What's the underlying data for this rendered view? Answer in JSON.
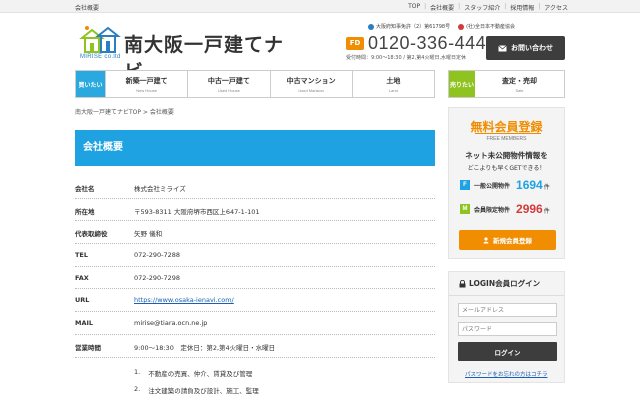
{
  "topbar": {
    "page_label": "会社概要",
    "links": [
      "TOP",
      "会社概要",
      "スタッフ紹介",
      "採用情報",
      "アクセス"
    ]
  },
  "logo": {
    "brand_jp": "南大阪一戸建てナビ",
    "brand_en": "MIRISE co.ltd"
  },
  "licenses": {
    "license1": "大阪府知事免許（2）第61798号",
    "license2": "(社)全日本不動産協会"
  },
  "contact": {
    "free_dial": "FD",
    "tel": "0120-336-444",
    "hours": "受付時間：9:00～18:30 / 第2,第4火曜日,水曜日定休",
    "inquiry_button": "お問い合わせ"
  },
  "nav": {
    "buy_label": "買いたい",
    "items": [
      {
        "jp": "新築一戸建て",
        "en": "New House"
      },
      {
        "jp": "中古一戸建て",
        "en": "Used House"
      },
      {
        "jp": "中古マンション",
        "en": "Used Mansion"
      },
      {
        "jp": "土地",
        "en": "Land"
      }
    ],
    "sell_label": "売りたい",
    "sell_item": {
      "jp": "査定・売却",
      "en": "Sale"
    }
  },
  "breadcrumb": "南大阪一戸建てナビTOP > 会社概要",
  "page_title": "会社概要",
  "company_info": [
    {
      "key": "会社名",
      "value": "株式会社ミライズ"
    },
    {
      "key": "所在地",
      "value": "〒593-8311 大阪府堺市西区上647-1-101"
    },
    {
      "key": "代表取締役",
      "value": "矢野 儀和"
    },
    {
      "key": "TEL",
      "value": "072-290-7288"
    },
    {
      "key": "FAX",
      "value": "072-290-7298"
    },
    {
      "key": "URL",
      "value": "https://www.osaka-ienavi.com/"
    },
    {
      "key": "MAIL",
      "value": "mirise@tiara.ocn.ne.jp"
    },
    {
      "key": "営業時間",
      "value": "9:00～18:30　定休日：第2,第4火曜日・水曜日"
    }
  ],
  "business": [
    {
      "num": "1.",
      "text": "不動産の売買、仲介、賃貸及び管理"
    },
    {
      "num": "2.",
      "text": "注文建築の請負及び設計、施工、監理"
    }
  ],
  "member": {
    "title": "無料会員登録",
    "subtitle": "FREE MEMBERS",
    "desc1": "ネット未公開物件情報を",
    "desc2": "どこよりも早くGETできる！",
    "stats": [
      {
        "badge": "F",
        "label": "一般公開物件",
        "count": "1694",
        "unit": "件",
        "color": "#1ea2e2"
      },
      {
        "badge": "M",
        "label": "会員限定物件",
        "count": "2996",
        "unit": "件",
        "color": "#8fc320"
      }
    ],
    "register_button": "新規会員登録"
  },
  "login": {
    "title": "LOGIN会員ログイン",
    "email_placeholder": "メールアドレス",
    "password_placeholder": "パスワード",
    "login_button": "ログイン",
    "forgot_link": "パスワードをお忘れの方はコチラ"
  },
  "colors": {
    "accent_blue": "#1ea2e2",
    "accent_green": "#8fc320",
    "accent_orange": "#f08d00",
    "dark_button": "#3d3d3d"
  }
}
